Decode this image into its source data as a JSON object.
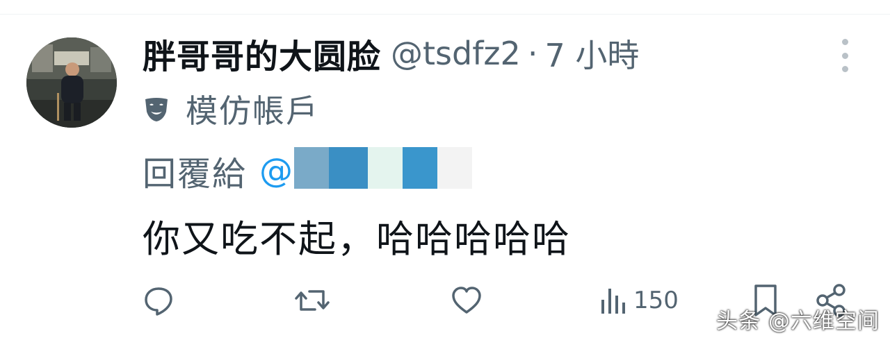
{
  "tweet": {
    "author": {
      "display_name": "胖哥哥的大圆脸",
      "handle": "@tsdfz2",
      "separator": "·",
      "time": "7 小時",
      "avatar_icon": "avatar-photo"
    },
    "parody": {
      "icon": "theater-mask-icon",
      "label": "模仿帳戶"
    },
    "reply": {
      "label": "回覆給",
      "mention_prefix": "@"
    },
    "text": "你又吃不起，哈哈哈哈哈"
  },
  "actions": {
    "reply_icon": "reply-icon",
    "retweet_icon": "retweet-icon",
    "like_icon": "like-icon",
    "views_icon": "views-icon",
    "views_count": "150",
    "bookmark_icon": "bookmark-icon",
    "share_icon": "share-icon"
  },
  "more_icon": "more-vertical-icon",
  "watermark": "头条 @六维空间",
  "colors": {
    "text_primary": "#0f1419",
    "text_secondary": "#536471",
    "link": "#1d9bf0"
  }
}
